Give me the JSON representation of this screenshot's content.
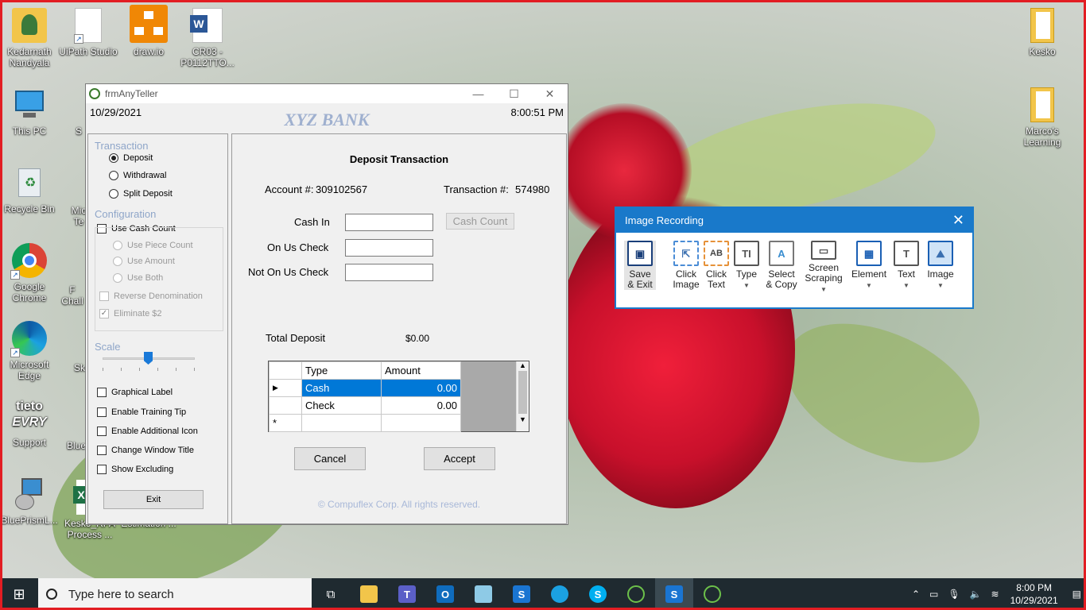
{
  "desktop": {
    "icons": [
      {
        "label": "Kedarnath Nandyala"
      },
      {
        "label": "UiPath Studio"
      },
      {
        "label": "draw.io"
      },
      {
        "label": "CR03 - P0112TTO..."
      },
      {
        "label": "This PC"
      },
      {
        "label": "Recycle Bin"
      },
      {
        "label": "Google Chrome"
      },
      {
        "label": "Microsoft Edge"
      },
      {
        "label": "Support"
      },
      {
        "label": "BluePrismL..."
      },
      {
        "label": "Kesko_RPA Process ..."
      },
      {
        "label": "Efforts and Estimation ..."
      },
      {
        "label": "Kesko"
      },
      {
        "label": "Marco's Learning"
      }
    ],
    "partial": [
      "S",
      "Mic Te",
      "F Chall",
      "Sk",
      "Blue"
    ]
  },
  "teller": {
    "title": "frmAnyTeller",
    "date": "10/29/2021",
    "time": "8:00:51 PM",
    "bank": "XYZ BANK",
    "transaction_group": "Transaction",
    "radios": [
      {
        "label": "Deposit",
        "checked": true
      },
      {
        "label": "Withdrawal",
        "checked": false
      },
      {
        "label": "Split Deposit",
        "checked": false
      }
    ],
    "config_group": "Configuration",
    "use_cash_count": "Use Cash Count",
    "sub_radios": [
      "Use Piece Count",
      "Use Amount",
      "Use Both"
    ],
    "reverse_denom": "Reverse Denomination",
    "eliminate": "Eliminate $2",
    "scale": "Scale",
    "options": [
      "Graphical Label",
      "Enable Training Tip",
      "Enable Additional Icon",
      "Change Window Title",
      "Show Excluding"
    ],
    "exit": "Exit",
    "heading": "Deposit Transaction",
    "account_label": "Account #:",
    "account": "309102567",
    "txn_label": "Transaction #:",
    "txn": "574980",
    "cash_in": "Cash In",
    "cash_count_btn": "Cash Count",
    "on_us": "On Us Check",
    "not_on_us": "Not On Us Check",
    "total_label": "Total Deposit",
    "total": "$0.00",
    "grid_headers": [
      "Type",
      "Amount"
    ],
    "grid_rows": [
      {
        "type": "Cash",
        "amount": "0.00"
      },
      {
        "type": "Check",
        "amount": "0.00"
      }
    ],
    "new_row_marker": "*",
    "cancel": "Cancel",
    "accept": "Accept",
    "copyright": "© Compuflex Corp. All rights reserved."
  },
  "image_recording": {
    "title": "Image Recording",
    "tools": [
      {
        "label1": "Save",
        "label2": "& Exit"
      },
      {
        "label1": "Click",
        "label2": "Image"
      },
      {
        "label1": "Click",
        "label2": "Text"
      },
      {
        "label1": "Type",
        "label2": ""
      },
      {
        "label1": "Select",
        "label2": "& Copy"
      },
      {
        "label1": "Screen",
        "label2": "Scraping"
      },
      {
        "label1": "Element",
        "label2": ""
      },
      {
        "label1": "Text",
        "label2": ""
      },
      {
        "label1": "Image",
        "label2": ""
      }
    ]
  },
  "taskbar": {
    "search_placeholder": "Type here to search",
    "time": "8:00 PM",
    "date": "10/29/2021"
  }
}
